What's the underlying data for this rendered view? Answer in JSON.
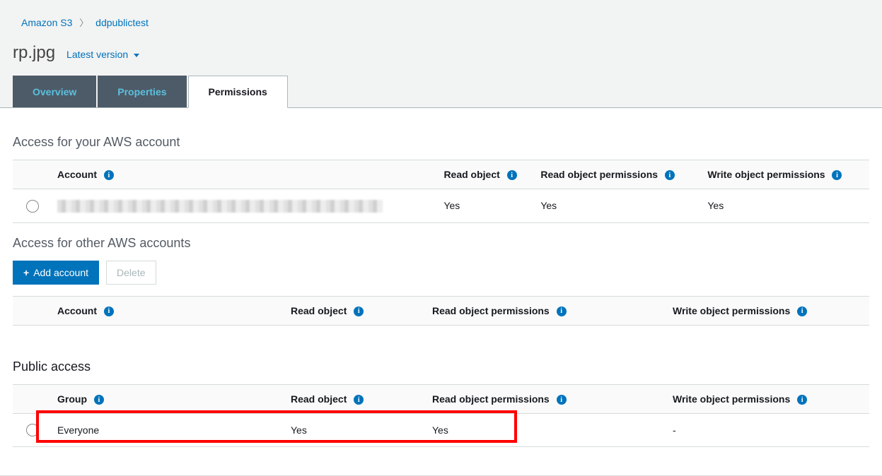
{
  "breadcrumb": {
    "root": "Amazon S3",
    "bucket": "ddpublictest"
  },
  "title": "rp.jpg",
  "version_label": "Latest version",
  "tabs": {
    "overview": "Overview",
    "properties": "Properties",
    "permissions": "Permissions"
  },
  "sections": {
    "own": "Access for your AWS account",
    "other": "Access for other AWS accounts",
    "public": "Public access"
  },
  "cols": {
    "account": "Account",
    "group": "Group",
    "read_obj": "Read object",
    "read_perm": "Read object permissions",
    "write_perm": "Write object permissions"
  },
  "own_row": {
    "read_obj": "Yes",
    "read_perm": "Yes",
    "write_perm": "Yes"
  },
  "buttons": {
    "add_account": "Add account",
    "delete": "Delete"
  },
  "public_row": {
    "group": "Everyone",
    "read_obj": "Yes",
    "read_perm": "Yes",
    "write_perm": "-"
  }
}
